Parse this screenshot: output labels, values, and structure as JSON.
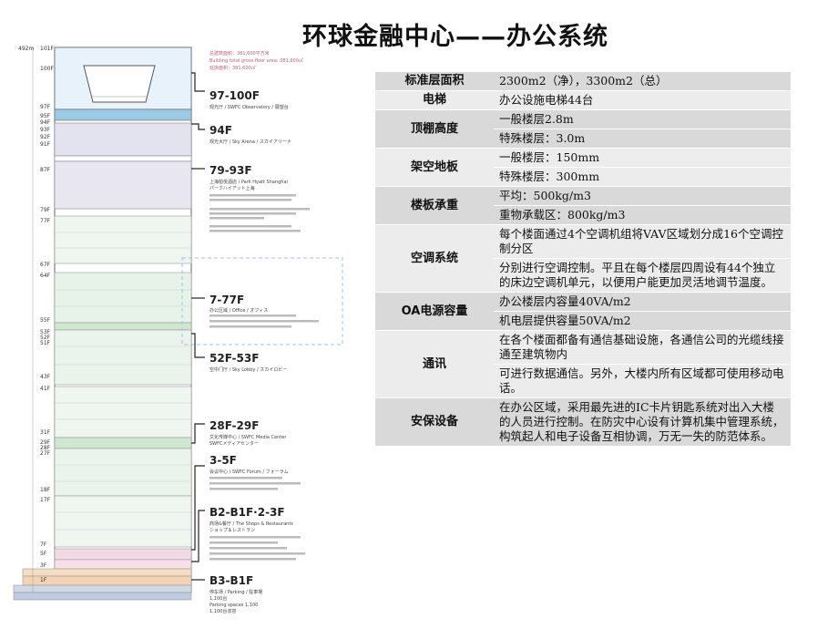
{
  "title": "环球金融中心——办公系统",
  "building": {
    "floor_labels": [
      "492m",
      "101F",
      "100F",
      "97F",
      "95F",
      "94F",
      "93F",
      "92F",
      "91F",
      "87F",
      "79F",
      "77F",
      "67F",
      "64F",
      "55F",
      "53F",
      "52F",
      "51F",
      "43F",
      "41F",
      "31F",
      "29F",
      "28F",
      "27F",
      "18F",
      "17F",
      "7F",
      "5F",
      "3F",
      "1F"
    ],
    "zones": [
      {
        "title": "97-100F",
        "sub": "观光厅 / SWFC Observatory / 展望台",
        "extra": "总建筑面积：381,600平方米",
        "extra2": "Building total gross floor area: 381,600㎡",
        "extra3": "延床面积：381,600㎡"
      },
      {
        "title": "94F",
        "sub": "观光大厅 / Sky Arena / スカイアリーナ"
      },
      {
        "title": "79-93F",
        "sub": "上海柏悦酒店 / Park Hyatt Shanghai",
        "sub2": "パークハイアット上海"
      },
      {
        "title": "7-77F",
        "sub": "办公区域 / Office / オフィス"
      },
      {
        "title": "52F-53F",
        "sub": "空中门厅 / Sky Lobby / スカイロビー"
      },
      {
        "title": "28F-29F",
        "sub": "文化传媒中心 / SWFC Media Center",
        "sub2": "SWFCメディアセンター"
      },
      {
        "title": "3-5F",
        "sub": "会议中心 / SWFC Forum / フォーラム"
      },
      {
        "title": "B2-B1F·2-3F",
        "sub": "商场&餐厅 / The Shops & Restaurants",
        "sub2": "ショップ＆レストラン"
      },
      {
        "title": "B3-B1F",
        "sub": "停车场 / Parking / 駐車場",
        "sub2": "1,100台",
        "sub3": "Parking spaces 1,100",
        "sub4": "1,100台収容"
      }
    ]
  },
  "table": [
    {
      "key": "标准层面积",
      "vals": [
        "2300m2（净），3300m2（总）"
      ]
    },
    {
      "key": "电梯",
      "vals": [
        "办公设施电梯44台"
      ]
    },
    {
      "key": "顶棚高度",
      "vals": [
        "一般楼层2.8m",
        "特殊楼层：3.0m"
      ]
    },
    {
      "key": "架空地板",
      "vals": [
        "一般楼层：150mm",
        "特殊楼层：300mm"
      ]
    },
    {
      "key": "楼板承重",
      "vals": [
        "平均：500kg/m3",
        "重物承载区：800kg/m3"
      ]
    },
    {
      "key": "空调系统",
      "vals": [
        "每个楼面通过4个空调机组将VAV区域划分成16个空调控制分区",
        "分别进行空调控制。平且在每个楼层四周设有44个独立的床边空调机单元，以便用户能更加灵活地调节温度。"
      ]
    },
    {
      "key": "OA电源容量",
      "vals": [
        "办公楼层内容量40VA/m2",
        "机电层提供容量50VA/m2"
      ]
    },
    {
      "key": "通讯",
      "vals": [
        "在各个楼面都备有通信基础设施，各通信公司的光缆线接通至建筑物内",
        "可进行数据通信。另外，大楼内所有区域都可使用移动电话。"
      ]
    },
    {
      "key": "安保设备",
      "vals": [
        "在办公区域，采用最先进的IC卡片钥匙系统对出入大楼的人员进行控制。在防灾中心设有计算机集中管理系统，构筑起人和电子设备互相协调，万无一失的防范体系。"
      ]
    }
  ]
}
